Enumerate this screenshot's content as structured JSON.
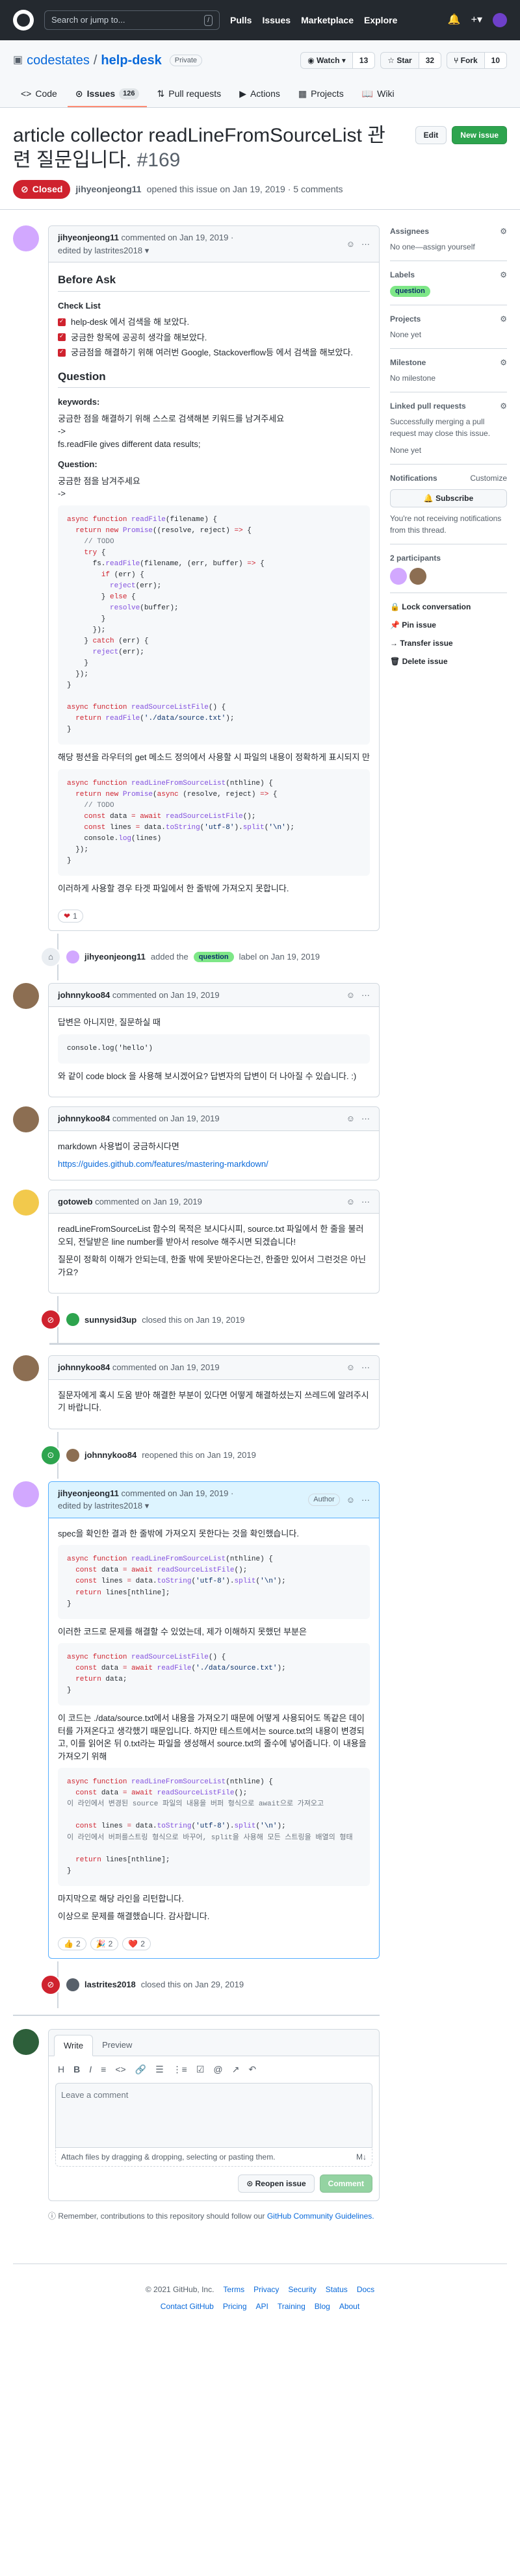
{
  "header": {
    "search_placeholder": "Search or jump to...",
    "search_kbd": "/",
    "nav": [
      "Pulls",
      "Issues",
      "Marketplace",
      "Explore"
    ]
  },
  "repo": {
    "owner": "codestates",
    "separator": "/",
    "name": "help-desk",
    "visibility": "Private",
    "watch_label": "Watch",
    "watch_count": "13",
    "star_label": "Star",
    "star_count": "32",
    "fork_label": "Fork",
    "fork_count": "10",
    "tabs": [
      {
        "label": "Code",
        "icon": "<>"
      },
      {
        "label": "Issues",
        "icon": "⊙",
        "count": "126"
      },
      {
        "label": "Pull requests",
        "icon": "⇅"
      },
      {
        "label": "Actions",
        "icon": "▶"
      },
      {
        "label": "Projects",
        "icon": "▦"
      },
      {
        "label": "Wiki",
        "icon": "📖"
      }
    ]
  },
  "issue": {
    "title": "article collector readLineFromSourceList 관련 질문입니다.",
    "number": "#169",
    "edit_label": "Edit",
    "new_issue_label": "New issue",
    "state": "Closed",
    "author": "jihyeonjeong11",
    "meta_rest": "opened this issue on Jan 19, 2019 · 5 comments"
  },
  "comments": {
    "c1": {
      "author": "jihyeonjeong11",
      "meta": "commented on Jan 19, 2019 ·",
      "edited": "edited by lastrites2018 ▾",
      "before_ask": "Before Ask",
      "check_list": "Check List",
      "checks": [
        "help-desk 에서 검색을 해 보았다.",
        "궁금한 항목에 공공히 생각을 해보았다.",
        "궁금점을 해결하기 위해 여러번 Google, Stackoverflow등 에서 검색을 해보았다."
      ],
      "question_h": "Question",
      "keywords_h": "keywords:",
      "kw_line1": "궁금한 점을 해결하기 위해 스스로 검색해본 키워드를 남겨주세요",
      "kw_line2": "->",
      "kw_line3": "fs.readFile gives different data results;",
      "question2_h": "Question:",
      "q_line1": "궁금한 점을 남겨주세요",
      "q_line2": "->",
      "text_after_code": "해당 펑션을 라우터의 get 메소드 정의에서 사용할 시 파일의 내용이 정확하게 표시되지 만",
      "text_end": "이러하게 사용할 경우 타겟 파일에서 한 줄밖에 가져오지 못합니다.",
      "reaction": "1"
    },
    "c2": {
      "author": "johnnykoo84",
      "meta": "commented on Jan 19, 2019",
      "text1": "답변은 아니지만, 질문하실 때",
      "code": "console.log('hello')",
      "text2": "와 같이 code block 을 사용해 보시겠어요? 답변자의 답변이 더 나아질 수 있습니다. :)"
    },
    "c3": {
      "author": "johnnykoo84",
      "meta": "commented on Jan 19, 2019",
      "text1": "markdown 사용법이 궁금하시다면",
      "link": "https://guides.github.com/features/mastering-markdown/"
    },
    "c4": {
      "author": "gotoweb",
      "meta": "commented on Jan 19, 2019",
      "text1": "readLineFromSourceList 함수의 목적은 보시다시피, source.txt 파일에서 한 줄을 불러오되, 전달받은 line number를 받아서 resolve 해주시면 되겠습니다!",
      "text2": "질문이 정확히 이해가 안되는데, 한줄 밖에 못받아온다는건, 한줄만 있어서 그런것은 아닌가요?"
    },
    "c5": {
      "author": "johnnykoo84",
      "meta": "commented on Jan 19, 2019",
      "text1": "질문자에게 혹시 도움 받아 해결한 부분이 있다면 어떻게 해결하셨는지 쓰레드에 알려주시기 바랍니다."
    },
    "c6": {
      "author": "jihyeonjeong11",
      "meta": "commented on Jan 19, 2019 ·",
      "edited": "edited by lastrites2018 ▾",
      "author_badge": "Author",
      "text1": "spec을 확인한 결과 한 줄밖에 가져오지 못한다는 것을 확인했습니다.",
      "text2": "이러한 코드로 문제를 해결할 수 있었는데, 제가 이해하지 못했던 부분은",
      "text3": "이 코드는 ./data/source.txt에서 내용을 가져오기 때문에 어떻게 사용되어도 똑같은 데이터를 가져온다고 생각했기 때문입니다. 하지만 테스트에서는 source.txt의 내용이 변경되고, 이를 읽어온 뒤 0.txt라는 파일을 생성해서 source.txt의 줄수에 넣어줍니다. 이 내용을 가져오기 위해",
      "text4": "마지막으로 해당 라인을 리턴합니다.",
      "text5": "이상으로 문제를 해결했습니다. 감사합니다.",
      "reactions": [
        {
          "emoji": "👍",
          "count": "2"
        },
        {
          "emoji": "🎉",
          "count": "2"
        },
        {
          "emoji": "❤️",
          "count": "2"
        }
      ]
    }
  },
  "events": {
    "label_event": {
      "actor": "jihyeonjeong11",
      "pre": "added the",
      "label": "question",
      "post": "label on Jan 19, 2019"
    },
    "closed1": {
      "actor": "sunnysid3up",
      "text": "closed this on Jan 19, 2019"
    },
    "reopened": {
      "actor": "johnnykoo84",
      "text": "reopened this on Jan 19, 2019"
    },
    "closed2": {
      "actor": "lastrites2018",
      "text": "closed this on Jan 29, 2019"
    }
  },
  "sidebar": {
    "assignees_h": "Assignees",
    "assignees_v": "No one—assign yourself",
    "labels_h": "Labels",
    "label": "question",
    "projects_h": "Projects",
    "projects_v": "None yet",
    "milestone_h": "Milestone",
    "milestone_v": "No milestone",
    "linked_h": "Linked pull requests",
    "linked_desc": "Successfully merging a pull request may close this issue.",
    "linked_v": "None yet",
    "notif_h": "Notifications",
    "notif_customize": "Customize",
    "subscribe": "Subscribe",
    "notif_desc": "You're not receiving notifications from this thread.",
    "participants_h": "2 participants",
    "actions": [
      "Lock conversation",
      "Pin issue",
      "Transfer issue",
      "Delete issue"
    ]
  },
  "editor": {
    "tab_write": "Write",
    "tab_preview": "Preview",
    "toolbar": [
      "H",
      "B",
      "I",
      "≡",
      "<>",
      "🔗",
      "☰",
      "⋮≡",
      "☑",
      "@",
      "↗",
      "↶"
    ],
    "placeholder": "Leave a comment",
    "attach": "Attach files by dragging & dropping, selecting or pasting them.",
    "reopen": "Reopen issue",
    "comment": "Comment",
    "tip_pre": "Remember, contributions to this repository should follow our",
    "tip_link": "GitHub Community Guidelines."
  },
  "footer": {
    "row1": [
      "© 2021 GitHub, Inc.",
      "Terms",
      "Privacy",
      "Security",
      "Status",
      "Docs"
    ],
    "row2": [
      "Contact GitHub",
      "Pricing",
      "API",
      "Training",
      "Blog",
      "About"
    ]
  }
}
